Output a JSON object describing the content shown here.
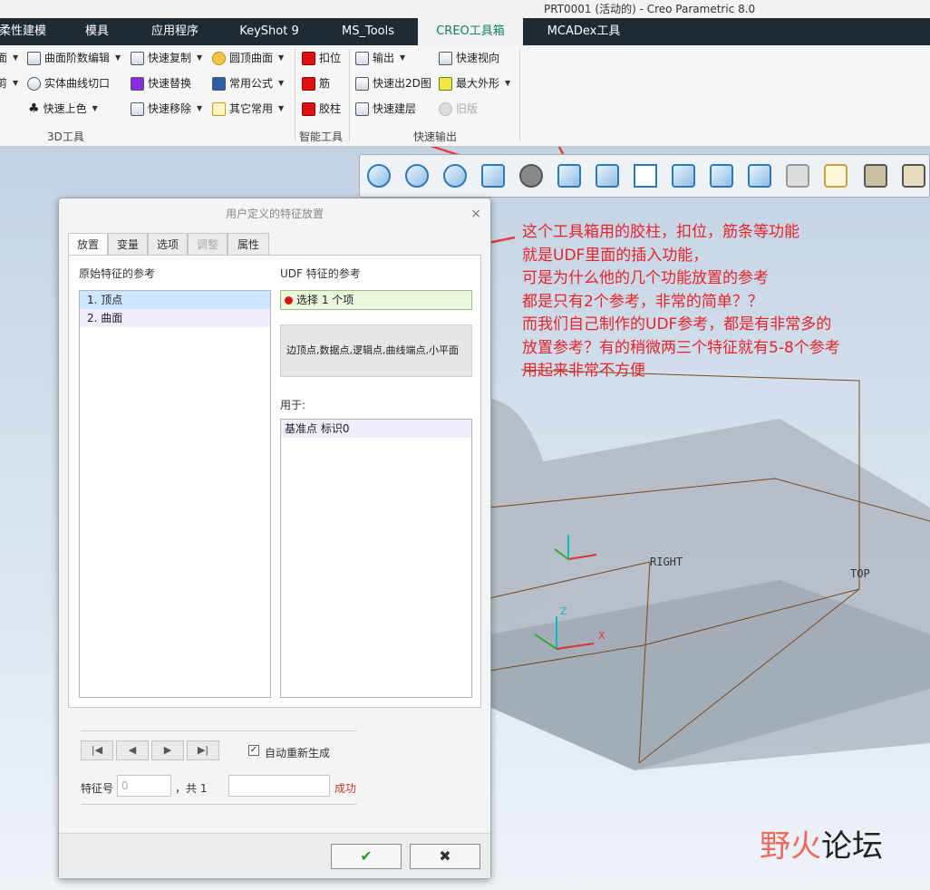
{
  "window": {
    "title": "PRT0001 (活动的) - Creo Parametric 8.0"
  },
  "tabs": [
    {
      "label": "柔性建模"
    },
    {
      "label": "模具"
    },
    {
      "label": "应用程序"
    },
    {
      "label": "KeyShot 9"
    },
    {
      "label": "MS_Tools"
    },
    {
      "label": "CREO工具箱",
      "active": true
    },
    {
      "label": "MCADex工具"
    }
  ],
  "ribbon": {
    "row1": [
      {
        "label": "面",
        "icon": "surface-icon"
      },
      {
        "label": "曲面阶数编辑",
        "icon": "surface-degree-icon"
      },
      {
        "label": "快速复制",
        "icon": "copy-icon"
      },
      {
        "label": "圆顶曲面",
        "icon": "dome-icon"
      },
      {
        "label": "扣位",
        "icon": "snap-icon"
      },
      {
        "label": "输出",
        "icon": "export-icon"
      },
      {
        "label": "快速视向",
        "icon": "view-icon"
      }
    ],
    "row2": [
      {
        "label": "剪",
        "icon": "trim-icon"
      },
      {
        "label": "实体曲线切口",
        "icon": "curve-cut-icon"
      },
      {
        "label": "快速替换",
        "icon": "replace-icon"
      },
      {
        "label": "常用公式",
        "icon": "formula-icon"
      },
      {
        "label": "筋",
        "icon": "rib-icon"
      },
      {
        "label": "快速出2D图",
        "icon": "drawing-icon"
      },
      {
        "label": "最大外形",
        "icon": "bounding-icon"
      }
    ],
    "row3": [
      {
        "label": "快速上色",
        "icon": "color-icon"
      },
      {
        "label": "快速移除",
        "icon": "remove-icon"
      },
      {
        "label": "其它常用",
        "icon": "other-icon"
      },
      {
        "label": "胶柱",
        "icon": "boss-icon"
      },
      {
        "label": "快速建层",
        "icon": "layer-icon"
      },
      {
        "label": "旧版",
        "icon": "legacy-icon",
        "disabled": true
      }
    ],
    "groups": {
      "g1": "3D工具",
      "g2": "智能工具",
      "g3": "快速输出"
    }
  },
  "dialog": {
    "title": "用户定义的特征放置",
    "close": "×",
    "tabs": [
      "放置",
      "变量",
      "选项",
      "调整",
      "属性"
    ],
    "left_header": "原始特征的参考",
    "original_refs": [
      "1. 顶点",
      "2. 曲面"
    ],
    "right_header": "UDF 特征的参考",
    "selection": "选择 1 个项",
    "hint": "边顶点,数据点,逻辑点,曲线端点,小平面",
    "used_for_label": "用于:",
    "used_for_items": [
      "基准点 标识0"
    ],
    "auto_regen": "自动重新生成",
    "feature_no_label": "特征号",
    "feature_no_value": "0",
    "total_label": "，共 1",
    "status": "成功",
    "ok": "✔",
    "cancel": "✖"
  },
  "annotation": [
    "这个工具箱用的胶柱，扣位，筋条等功能",
    "就是UDF里面的插入功能，",
    "可是为什么他的几个功能放置的参考",
    "都是只有2个参考，非常的简单？？",
    "而我们自己制作的UDF参考，都是有非常多的",
    "放置参考？有的稍微两三个特征就有5-8个参考",
    "用起来非常不方便"
  ],
  "viewport": {
    "right_label": "RIGHT",
    "top_label": "TOP",
    "axis_x": "X",
    "axis_z": "Z"
  },
  "watermark": {
    "a": "野火",
    "b": "论坛"
  }
}
